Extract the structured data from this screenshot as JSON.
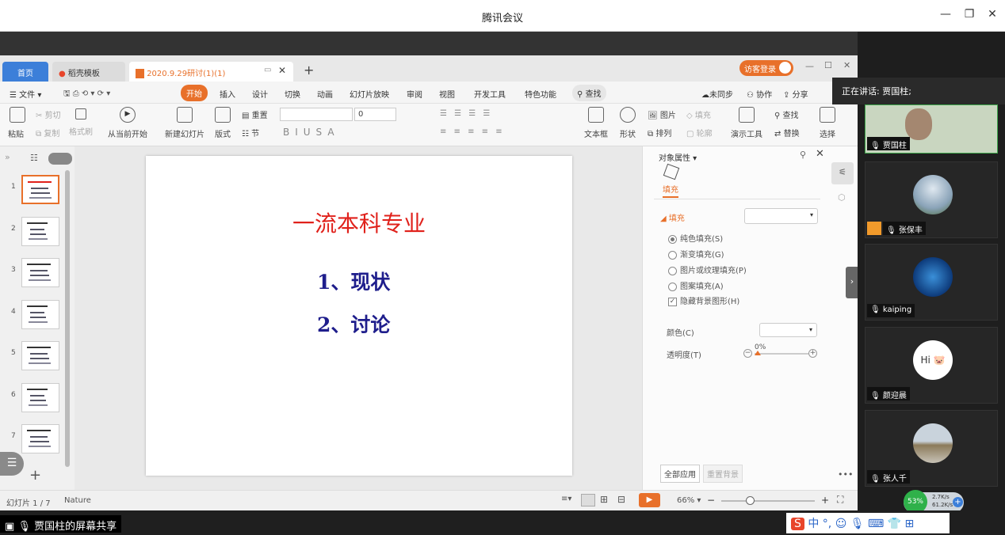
{
  "window": {
    "title": "腾讯会议"
  },
  "tabs": [
    {
      "label": "首页"
    },
    {
      "label": "稻壳模板"
    },
    {
      "label": "2020.9.29研讨(1)(1)"
    }
  ],
  "login_button": "访客登录",
  "ribbon": {
    "file": "文件",
    "tabs": [
      "开始",
      "插入",
      "设计",
      "切换",
      "动画",
      "幻灯片放映",
      "审阅",
      "视图",
      "开发工具",
      "特色功能"
    ],
    "search": "查找",
    "right": {
      "sync": "未同步",
      "collab": "协作",
      "share": "分享"
    }
  },
  "toolbar": {
    "paste": "粘贴",
    "cut": "剪切",
    "copy": "复制",
    "format_painter": "格式刷",
    "from_current": "从当前开始",
    "new_slide": "新建幻灯片",
    "layout": "版式",
    "reset": "重置",
    "section": "节",
    "font_size": "0",
    "textbox": "文本框",
    "shape": "形状",
    "picture": "图片",
    "fill": "填充",
    "arrange": "排列",
    "outline": "轮廓",
    "presenter": "演示工具",
    "find": "查找",
    "replace": "替换",
    "select": "选择"
  },
  "slides": {
    "numbers": [
      "1",
      "2",
      "3",
      "4",
      "5",
      "6",
      "7"
    ]
  },
  "slide": {
    "title": "一流本科专业",
    "item1": "1、现状",
    "item2": "2、讨论"
  },
  "props": {
    "header": "对象属性",
    "tab": "填充",
    "section": "填充",
    "options": [
      "纯色填充(S)",
      "渐变填充(G)",
      "图片或纹理填充(P)",
      "图案填充(A)"
    ],
    "hide_bg": "隐藏背景图形(H)",
    "color_label": "颜色(C)",
    "transparency_label": "透明度(T)",
    "transparency_value": "0%",
    "apply_all": "全部应用",
    "reset_bg": "重置背景"
  },
  "status": {
    "slide_count": "幻灯片 1 / 7",
    "theme": "Nature",
    "zoom": "66%"
  },
  "share": {
    "label": "贾国柱的屏幕共享"
  },
  "meeting": {
    "speaking": "正在讲话: 贾国柱;",
    "participants": [
      {
        "name": "贾国柱"
      },
      {
        "name": "张保丰"
      },
      {
        "name": "kaiping"
      },
      {
        "name": "颜迎晨"
      },
      {
        "name": "张人千"
      }
    ]
  },
  "tray": {
    "cpu": "53%",
    "up": "2.7K/s",
    "down": "61.2K/s",
    "ime": "中"
  },
  "colors": {
    "accent_orange": "#e8702a",
    "slide_title_red": "#e0211b",
    "slide_text_blue": "#1f1e8c",
    "tab_blue": "#3c7fd9"
  }
}
